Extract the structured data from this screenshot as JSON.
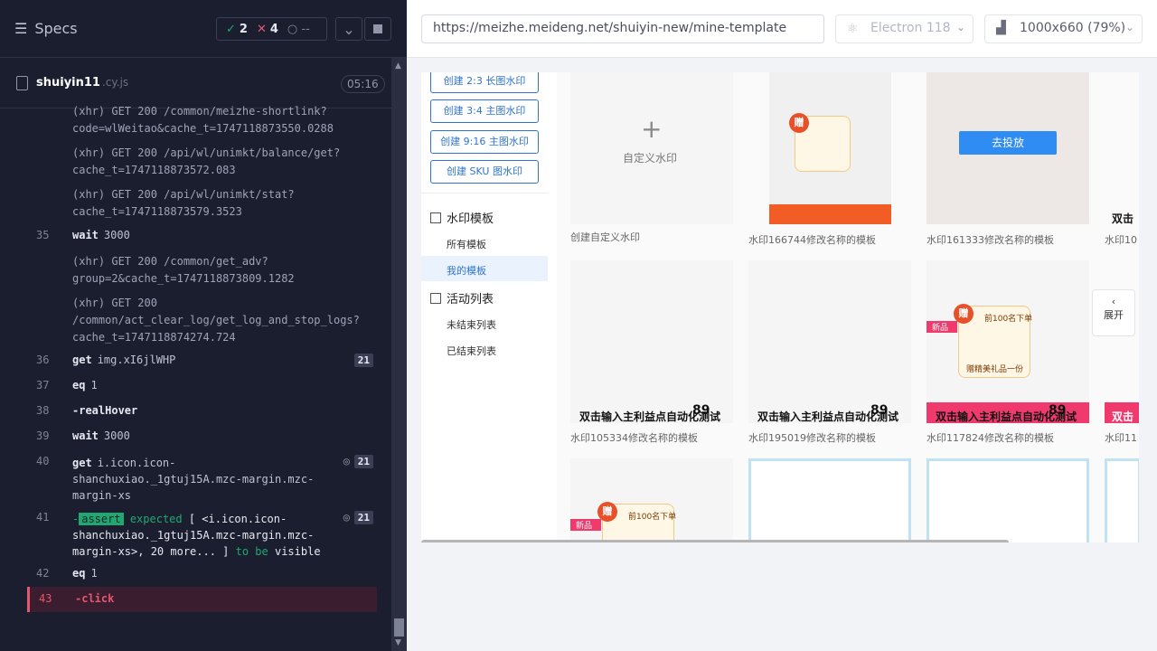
{
  "runner": {
    "specs_label": "Specs",
    "passed": "2",
    "failed": "4",
    "pending": "--",
    "spec_file": "shuiyin11",
    "spec_ext": ".cy.js",
    "duration": "05:16"
  },
  "commands": [
    {
      "line1": "(xhr)  GET 200 /common/meizhe-shortlink?",
      "line2": "code=wlWeitao&cache_t=1747118873550.0288"
    },
    {
      "line1": "(xhr)  GET 200 /api/wl/unimkt/balance/get?",
      "line2": "cache_t=1747118873572.083"
    },
    {
      "line1": "(xhr)  GET 200 /api/wl/unimkt/stat?",
      "line2": "cache_t=1747118873579.3523"
    },
    {
      "num": "35",
      "cmd": "wait",
      "msg": "3000"
    },
    {
      "line1": "(xhr)  GET 200 /common/get_adv?",
      "line2": "group=2&cache_t=1747118873809.1282"
    },
    {
      "line1": "(xhr)  GET 200",
      "line2": "/common/act_clear_log/get_log_and_stop_logs?",
      "line3": "cache_t=1747118874274.724"
    },
    {
      "num": "36",
      "cmd": "get",
      "msg": "img.xI6jlWHP",
      "badge": "21"
    },
    {
      "num": "37",
      "cmd": "eq",
      "msg": "1"
    },
    {
      "num": "38",
      "cmd": "-realHover",
      "msg": ""
    },
    {
      "num": "39",
      "cmd": "wait",
      "msg": "3000"
    },
    {
      "num": "40",
      "cmd": "get",
      "msg": "i.icon.icon-",
      "msg2": "shanchuxiao._1gtuj15A.mzc-margin.mzc-",
      "msg3": "margin-xs",
      "badge": "21"
    },
    {
      "num": "41",
      "assert_tag": "assert",
      "a1": "expected",
      "a2": "[ <i.icon.icon-",
      "a3": "shanchuxiao._1gtuj15A.mzc-margin.mzc-",
      "a4": "margin-xs>, 20 more... ]",
      "a5": "to be",
      "a6": "visible",
      "badge": "21"
    },
    {
      "num": "42",
      "cmd": "eq",
      "msg": "1"
    },
    {
      "num": "43",
      "cmd": "-click",
      "msg": ""
    }
  ],
  "browser": {
    "url": "https://meizhe.meideng.net/shuiyin-new/mine-template",
    "engine": "Electron 118",
    "viewport": "1000x660  (79%)"
  },
  "app": {
    "create_buttons": [
      "创建 2:3 长图水印",
      "创建 3:4 主图水印",
      "创建 9:16 主图水印",
      "创建 SKU 图水印"
    ],
    "section_templates": "水印模板",
    "all_templates": "所有模板",
    "my_templates": "我的模板",
    "section_activities": "活动列表",
    "unfinished": "未结束列表",
    "finished": "已结束列表",
    "custom_label": "自定义水印",
    "custom_caption": "创建自定义水印",
    "deliver": "去投放",
    "expand": "展开",
    "gift_top": "前100名下单",
    "gift_bottom": "赠精美礼品一份",
    "zeng": "赠",
    "badge_new": "新品",
    "title_text": "双击输入主利益点自动化测试",
    "price": "89",
    "captions": [
      "水印166744修改名称的模板",
      "水印161333修改名称的模板",
      "水印10",
      "水印105334修改名称的模板",
      "水印195019修改名称的模板",
      "水印117824修改名称的模板",
      "水印11"
    ],
    "partial_title": "双击"
  }
}
